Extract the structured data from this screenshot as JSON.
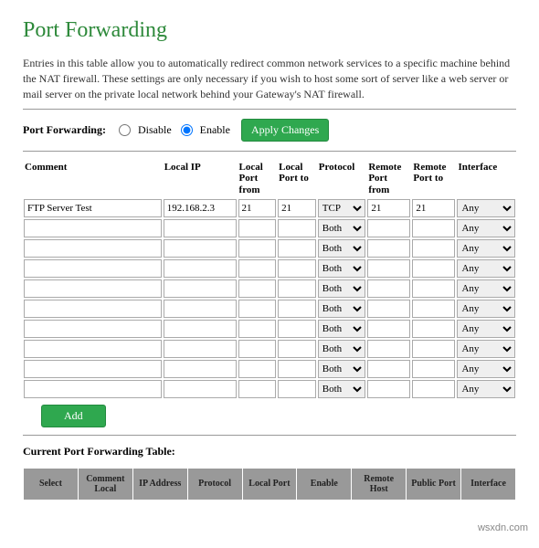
{
  "title": "Port Forwarding",
  "description": "Entries in this table allow you to automatically redirect common network services to a specific machine behind the NAT firewall. These settings are only necessary if you wish to host some sort of server like a web server or mail server on the private local network behind your Gateway's NAT firewall.",
  "toggle": {
    "label": "Port Forwarding:",
    "disable": "Disable",
    "enable": "Enable",
    "selected": "enable",
    "apply": "Apply Changes"
  },
  "headers": {
    "comment": "Comment",
    "local_ip": "Local IP",
    "local_port_from": "Local Port from",
    "local_port_to": "Local Port to",
    "protocol": "Protocol",
    "remote_port_from": "Remote Port from",
    "remote_port_to": "Remote Port to",
    "interface": "Interface"
  },
  "rows": [
    {
      "comment": "FTP Server Test",
      "local_ip": "192.168.2.3",
      "lpf": "21",
      "lpt": "21",
      "proto": "TCP",
      "rpf": "21",
      "rpt": "21",
      "iface": "Any"
    },
    {
      "comment": "",
      "local_ip": "",
      "lpf": "",
      "lpt": "",
      "proto": "Both",
      "rpf": "",
      "rpt": "",
      "iface": "Any"
    },
    {
      "comment": "",
      "local_ip": "",
      "lpf": "",
      "lpt": "",
      "proto": "Both",
      "rpf": "",
      "rpt": "",
      "iface": "Any"
    },
    {
      "comment": "",
      "local_ip": "",
      "lpf": "",
      "lpt": "",
      "proto": "Both",
      "rpf": "",
      "rpt": "",
      "iface": "Any"
    },
    {
      "comment": "",
      "local_ip": "",
      "lpf": "",
      "lpt": "",
      "proto": "Both",
      "rpf": "",
      "rpt": "",
      "iface": "Any"
    },
    {
      "comment": "",
      "local_ip": "",
      "lpf": "",
      "lpt": "",
      "proto": "Both",
      "rpf": "",
      "rpt": "",
      "iface": "Any"
    },
    {
      "comment": "",
      "local_ip": "",
      "lpf": "",
      "lpt": "",
      "proto": "Both",
      "rpf": "",
      "rpt": "",
      "iface": "Any"
    },
    {
      "comment": "",
      "local_ip": "",
      "lpf": "",
      "lpt": "",
      "proto": "Both",
      "rpf": "",
      "rpt": "",
      "iface": "Any"
    },
    {
      "comment": "",
      "local_ip": "",
      "lpf": "",
      "lpt": "",
      "proto": "Both",
      "rpf": "",
      "rpt": "",
      "iface": "Any"
    },
    {
      "comment": "",
      "local_ip": "",
      "lpf": "",
      "lpt": "",
      "proto": "Both",
      "rpf": "",
      "rpt": "",
      "iface": "Any"
    }
  ],
  "add_label": "Add",
  "current_table_heading": "Current Port Forwarding Table:",
  "current_headers": {
    "select": "Select",
    "comment_local": "Comment Local",
    "ip_address": "IP Address",
    "protocol": "Protocol",
    "local_port": "Local Port",
    "enable": "Enable",
    "remote_host": "Remote Host",
    "public_port": "Public Port",
    "interface": "Interface"
  },
  "watermark": "wsxdn.com"
}
